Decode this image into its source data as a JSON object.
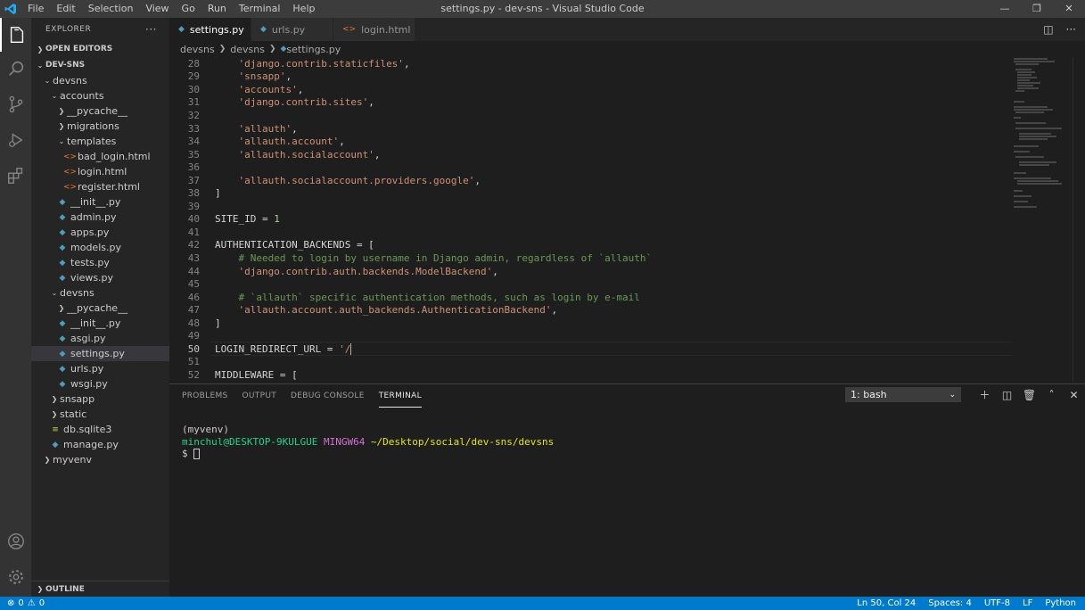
{
  "window": {
    "title": "settings.py - dev-sns - Visual Studio Code",
    "menu": [
      "File",
      "Edit",
      "Selection",
      "View",
      "Go",
      "Run",
      "Terminal",
      "Help"
    ]
  },
  "sidebar": {
    "title": "EXPLORER",
    "open_editors": "OPEN EDITORS",
    "root": "DEV-SNS",
    "tree": [
      {
        "label": "devsns",
        "kind": "folder-open",
        "depth": 1
      },
      {
        "label": "accounts",
        "kind": "folder-open",
        "depth": 2
      },
      {
        "label": "__pycache__",
        "kind": "folder-closed",
        "depth": 3
      },
      {
        "label": "migrations",
        "kind": "folder-closed",
        "depth": 3
      },
      {
        "label": "templates",
        "kind": "folder-open",
        "depth": 3
      },
      {
        "label": "bad_login.html",
        "kind": "html",
        "depth": 4
      },
      {
        "label": "login.html",
        "kind": "html",
        "depth": 4
      },
      {
        "label": "register.html",
        "kind": "html",
        "depth": 4
      },
      {
        "label": "__init__.py",
        "kind": "py",
        "depth": 3
      },
      {
        "label": "admin.py",
        "kind": "py",
        "depth": 3
      },
      {
        "label": "apps.py",
        "kind": "py",
        "depth": 3
      },
      {
        "label": "models.py",
        "kind": "py",
        "depth": 3
      },
      {
        "label": "tests.py",
        "kind": "py",
        "depth": 3
      },
      {
        "label": "views.py",
        "kind": "py",
        "depth": 3
      },
      {
        "label": "devsns",
        "kind": "folder-open",
        "depth": 2
      },
      {
        "label": "__pycache__",
        "kind": "folder-closed",
        "depth": 3
      },
      {
        "label": "__init__.py",
        "kind": "py",
        "depth": 3
      },
      {
        "label": "asgi.py",
        "kind": "py",
        "depth": 3
      },
      {
        "label": "settings.py",
        "kind": "py",
        "depth": 3,
        "selected": true
      },
      {
        "label": "urls.py",
        "kind": "py",
        "depth": 3
      },
      {
        "label": "wsgi.py",
        "kind": "py",
        "depth": 3
      },
      {
        "label": "snsapp",
        "kind": "folder-closed",
        "depth": 2
      },
      {
        "label": "static",
        "kind": "folder-closed",
        "depth": 2
      },
      {
        "label": "db.sqlite3",
        "kind": "db",
        "depth": 2
      },
      {
        "label": "manage.py",
        "kind": "py",
        "depth": 2
      },
      {
        "label": "myvenv",
        "kind": "folder-closed",
        "depth": 1
      }
    ],
    "outline": "OUTLINE"
  },
  "tabs": [
    {
      "label": "settings.py",
      "icon": "python-icon",
      "active": true
    },
    {
      "label": "urls.py",
      "icon": "python-icon",
      "active": false
    },
    {
      "label": "login.html",
      "icon": "html-icon",
      "active": false
    }
  ],
  "breadcrumb": [
    "devsns",
    "devsns",
    "settings.py"
  ],
  "code": [
    {
      "n": "28",
      "parts": [
        [
          "    ",
          ""
        ],
        [
          "'django.contrib.staticfiles'",
          "str"
        ],
        [
          ",",
          ""
        ]
      ]
    },
    {
      "n": "29",
      "parts": [
        [
          "    ",
          ""
        ],
        [
          "'snsapp'",
          "str"
        ],
        [
          ",",
          ""
        ]
      ]
    },
    {
      "n": "30",
      "parts": [
        [
          "    ",
          ""
        ],
        [
          "'accounts'",
          "str"
        ],
        [
          ",",
          ""
        ]
      ]
    },
    {
      "n": "31",
      "parts": [
        [
          "    ",
          ""
        ],
        [
          "'django.contrib.sites'",
          "str"
        ],
        [
          ",",
          ""
        ]
      ]
    },
    {
      "n": "32",
      "parts": []
    },
    {
      "n": "33",
      "parts": [
        [
          "    ",
          ""
        ],
        [
          "'allauth'",
          "str"
        ],
        [
          ",",
          ""
        ]
      ]
    },
    {
      "n": "34",
      "parts": [
        [
          "    ",
          ""
        ],
        [
          "'allauth.account'",
          "str"
        ],
        [
          ",",
          ""
        ]
      ]
    },
    {
      "n": "35",
      "parts": [
        [
          "    ",
          ""
        ],
        [
          "'allauth.socialaccount'",
          "str"
        ],
        [
          ",",
          ""
        ]
      ]
    },
    {
      "n": "36",
      "parts": []
    },
    {
      "n": "37",
      "parts": [
        [
          "    ",
          ""
        ],
        [
          "'allauth.socialaccount.providers.google'",
          "str"
        ],
        [
          ",",
          ""
        ]
      ]
    },
    {
      "n": "38",
      "parts": [
        [
          "]",
          ""
        ]
      ]
    },
    {
      "n": "39",
      "parts": []
    },
    {
      "n": "40",
      "parts": [
        [
          "SITE_ID = ",
          ""
        ],
        [
          "1",
          "num"
        ]
      ]
    },
    {
      "n": "41",
      "parts": []
    },
    {
      "n": "42",
      "parts": [
        [
          "AUTHENTICATION_BACKENDS = [",
          ""
        ]
      ]
    },
    {
      "n": "43",
      "parts": [
        [
          "    ",
          ""
        ],
        [
          "# Needed to login by username in Django admin, regardless of `allauth`",
          "com"
        ]
      ]
    },
    {
      "n": "44",
      "parts": [
        [
          "    ",
          ""
        ],
        [
          "'django.contrib.auth.backends.ModelBackend'",
          "str"
        ],
        [
          ",",
          ""
        ]
      ]
    },
    {
      "n": "45",
      "parts": []
    },
    {
      "n": "46",
      "parts": [
        [
          "    ",
          ""
        ],
        [
          "# `allauth` specific authentication methods, such as login by e-mail",
          "com"
        ]
      ]
    },
    {
      "n": "47",
      "parts": [
        [
          "    ",
          ""
        ],
        [
          "'allauth.account.auth_backends.AuthenticationBackend'",
          "str"
        ],
        [
          ",",
          ""
        ]
      ]
    },
    {
      "n": "48",
      "parts": [
        [
          "]",
          ""
        ]
      ]
    },
    {
      "n": "49",
      "parts": []
    },
    {
      "n": "50",
      "parts": [
        [
          "LOGIN_REDIRECT_URL = ",
          ""
        ],
        [
          "'/",
          "str"
        ]
      ],
      "current": true
    },
    {
      "n": "51",
      "parts": []
    },
    {
      "n": "52",
      "parts": [
        [
          "MIDDLEWARE = [",
          ""
        ]
      ]
    }
  ],
  "panel": {
    "tabs": [
      "PROBLEMS",
      "OUTPUT",
      "DEBUG CONSOLE",
      "TERMINAL"
    ],
    "active_tab": "TERMINAL",
    "shell_select": "1: bash",
    "terminal": {
      "line1": "(myvenv)",
      "user_host": "minchul@DESKTOP-9KULGUE",
      "env": "MINGW64",
      "path": "~/Desktop/social/dev-sns/devsns",
      "prompt": "$"
    }
  },
  "statusbar": {
    "errors": "0",
    "warnings": "0",
    "position": "Ln 50, Col 24",
    "spaces": "Spaces: 4",
    "encoding": "UTF-8",
    "eol": "LF",
    "language": "Python"
  },
  "colors": {
    "accent": "#007acc",
    "string": "#ce9178",
    "comment": "#6a9955",
    "number": "#b5cea8"
  }
}
